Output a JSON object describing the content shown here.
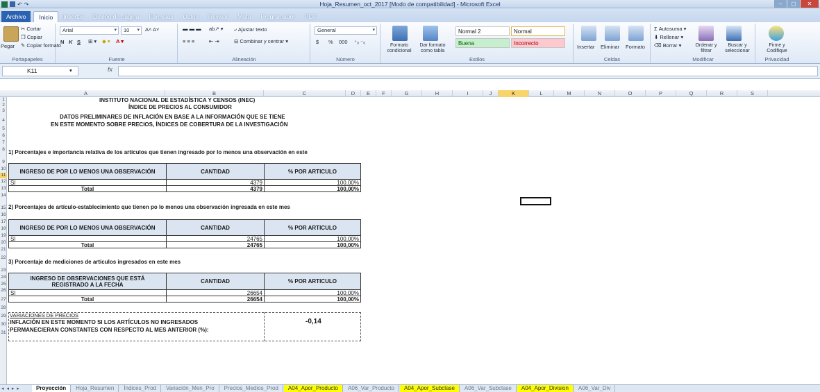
{
  "window": {
    "title": "Hoja_Resumen_oct_2017  [Modo de compatibilidad] - Microsoft Excel",
    "minimize": "–",
    "maximize": "▢",
    "close": "✕"
  },
  "ribbon_tabs": [
    "Archivo",
    "Inicio",
    "Insertar",
    "Diseño de página",
    "Fórmulas",
    "Datos",
    "Revisar",
    "Vista",
    "Programador",
    "PDF"
  ],
  "active_tab": "Inicio",
  "clipboard": {
    "paste": "Pegar",
    "cut": "Cortar",
    "copy": "Copiar",
    "format_painter": "Copiar formato",
    "label": "Portapapeles"
  },
  "font": {
    "name": "Arial",
    "size": "10",
    "label": "Fuente",
    "bold": "N",
    "italic": "K",
    "underline": "S"
  },
  "alignment": {
    "wrap": "Ajustar texto",
    "merge": "Combinar y centrar",
    "label": "Alineación"
  },
  "number": {
    "format": "General",
    "label": "Número",
    "currency": "$",
    "percent": "%",
    "thousands": "000"
  },
  "styles": {
    "conditional": "Formato condicional",
    "as_table": "Dar formato como tabla",
    "normal2": "Normal 2",
    "normal": "Normal",
    "good": "Buena",
    "bad": "Incorrecto",
    "label": "Estilos"
  },
  "cells": {
    "insert": "Insertar",
    "delete": "Eliminar",
    "format": "Formato",
    "label": "Celdas"
  },
  "editing": {
    "autosum": "Autosuma",
    "fill": "Rellenar",
    "clear": "Borrar",
    "sort": "Ordenar y filtrar",
    "find": "Buscar y seleccionar",
    "label": "Modificar"
  },
  "privacy": {
    "sign": "Firme y Codifique",
    "label": "Privacidad"
  },
  "name_box": "K11",
  "fx": "fx",
  "columns": [
    "A",
    "B",
    "C",
    "D",
    "E",
    "F",
    "G",
    "H",
    "I",
    "J",
    "K",
    "L",
    "M",
    "N",
    "O",
    "P",
    "Q",
    "R",
    "S"
  ],
  "selected_column": "K",
  "rows": [
    "1",
    "2",
    "3",
    "4",
    "5",
    "6",
    "7",
    "8",
    "9",
    "10",
    "11",
    "12",
    "13",
    "14",
    "15",
    "16",
    "17",
    "18",
    "19",
    "20",
    "21",
    "22",
    "23",
    "24",
    "25",
    "26",
    "27",
    "28",
    "29",
    "30",
    "31"
  ],
  "header": {
    "line1": "INSTITUTO NACIONAL DE ESTADÍSTICA Y CENSOS (INEC)",
    "line2": "ÍNDICE DE PRECIOS AL CONSUMIDOR",
    "line3": "DATOS PRELIMINARES DE INFLACIÓN EN BASE A LA INFORMACIÓN QUE SE TIENE",
    "line4": "EN ESTE MOMENTO SOBRE PRECIOS, ÍNDICES DE COBERTURA DE LA INVESTIGACIÓN"
  },
  "sections": [
    {
      "title": "1) Porcentajes e importancia relativa de los artículos que tienen ingresado por lo menos una observación en este",
      "col1": "INGRESO DE POR LO MENOS UNA OBSERVACIÓN",
      "col2": "CANTIDAD",
      "col3": "% POR ARTICULO",
      "row_label": "SI",
      "row_qty": "4379",
      "row_pct": "100,00%",
      "total_label": "Total",
      "total_qty": "4379",
      "total_pct": "100,00%"
    },
    {
      "title": "2) Porcentajes de  artículo-establecimiento que tienen po lo menos una observación ingresada en este mes",
      "col1": "INGRESO DE POR LO MENOS UNA OBSERVACIÓN",
      "col2": "CANTIDAD",
      "col3": "% POR ARTICULO",
      "row_label": "SI",
      "row_qty": "24765",
      "row_pct": "100,00%",
      "total_label": "Total",
      "total_qty": "24765",
      "total_pct": "100,00%"
    },
    {
      "title": "3) Porcentaje de mediciones de artículos ingresados en este mes",
      "col1": "INGRESO DE OBSERVACIONES QUE ESTÁ REGISTRADO A LA FECHA",
      "col2": "CANTIDAD",
      "col3": "% POR ARTICULO",
      "row_label": "SI",
      "row_qty": "26654",
      "row_pct": "100,00%",
      "total_label": "Total",
      "total_qty": "26654",
      "total_pct": "100,00%"
    }
  ],
  "variation": {
    "heading": "VARIACIONES DE PRECIOS",
    "text1": "INFLACIÓN EN ESTE MOMENTO SI LOS ARTÍCULOS NO INGRESADOS",
    "text2": "PERMANECIERAN CONSTANTES CON RESPECTO AL MES ANTERIOR (%):",
    "value": "-0,14"
  },
  "sheet_nav": "◂ ◂ ▸ ▸",
  "sheet_tabs": [
    {
      "label": "Proyección",
      "style": "active"
    },
    {
      "label": "Hoja_Resumen",
      "style": "plain"
    },
    {
      "label": "Índices_Prod",
      "style": "plain"
    },
    {
      "label": "Variación_Men_Pro",
      "style": "plain"
    },
    {
      "label": "Precios_Medios_Prod",
      "style": "plain"
    },
    {
      "label": "A04_Apor_Producto",
      "style": "yellow"
    },
    {
      "label": "A06_Var_Producto",
      "style": "plain"
    },
    {
      "label": "A04_Apor_Subclase",
      "style": "yellow"
    },
    {
      "label": "A06_Var_Subclase",
      "style": "plain"
    },
    {
      "label": "A04_Apor_Division",
      "style": "yellow"
    },
    {
      "label": "A06_Var_Div",
      "style": "plain"
    }
  ],
  "colors": {
    "header_fill": "#dbe5f1",
    "selected_header": "#f8d56c",
    "file_tab": "#2c62b2",
    "good": "#c6efce",
    "bad": "#ffc7ce",
    "sheet_tab_yellow": "#ffff00"
  }
}
